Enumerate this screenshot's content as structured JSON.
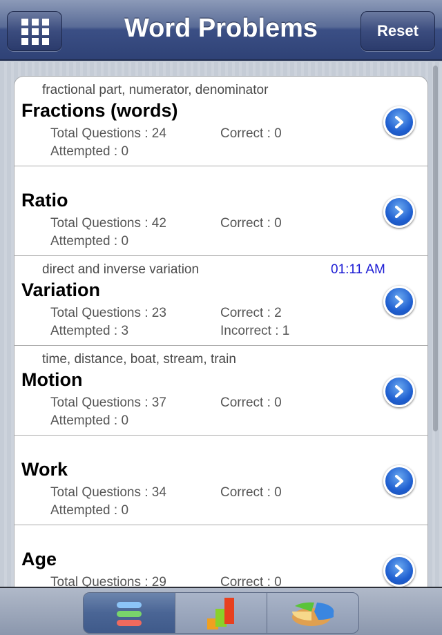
{
  "header": {
    "title": "Word Problems",
    "reset_label": "Reset",
    "menu_icon": "grid-icon"
  },
  "labels": {
    "total": "Total Questions : ",
    "correct": "Correct : ",
    "attempted": "Attempted : ",
    "incorrect": "Incorrect : "
  },
  "items": [
    {
      "subtitle": "fractional part, numerator, denominator",
      "name": "Fractions (words)",
      "total": "Total Questions : 24",
      "correct": "Correct : 0",
      "attempted": "Attempted : 0"
    },
    {
      "subtitle": "",
      "name": "Ratio",
      "total": "Total Questions : 42",
      "correct": "Correct : 0",
      "attempted": "Attempted : 0"
    },
    {
      "subtitle": "direct and inverse variation",
      "time": "01:11 AM",
      "name": "Variation",
      "total": "Total Questions : 23",
      "correct": "Correct : 2",
      "attempted": "Attempted : 3",
      "incorrect": "Incorrect : 1"
    },
    {
      "subtitle": "time, distance, boat, stream, train",
      "name": "Motion",
      "total": "Total Questions : 37",
      "correct": "Correct : 0",
      "attempted": "Attempted : 0"
    },
    {
      "subtitle": "",
      "name": "Work",
      "total": "Total Questions : 34",
      "correct": "Correct : 0",
      "attempted": "Attempted : 0"
    },
    {
      "subtitle": "",
      "name": "Age",
      "total": "Total Questions : 29",
      "correct": "Correct : 0",
      "attempted": ""
    }
  ],
  "tabbar": {
    "tabs": [
      {
        "icon": "list-icon",
        "selected": true
      },
      {
        "icon": "bar-chart-icon",
        "selected": false
      },
      {
        "icon": "pie-chart-icon",
        "selected": false
      }
    ]
  },
  "colors": {
    "nav": "#3b4f85",
    "time": "#1a1ad4",
    "chevron": "#1f5fd0"
  }
}
